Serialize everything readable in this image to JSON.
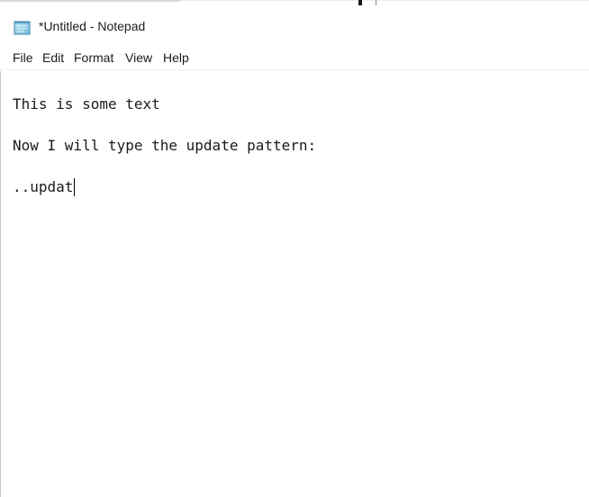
{
  "window": {
    "title": "*Untitled - Notepad",
    "icon": "notepad-icon"
  },
  "menu": {
    "file": "File",
    "edit": "Edit",
    "format": "Format",
    "view": "View",
    "help": "Help"
  },
  "editor": {
    "lines": [
      "This is some text",
      "",
      "Now I will type the update pattern:",
      "",
      "..updat"
    ]
  }
}
